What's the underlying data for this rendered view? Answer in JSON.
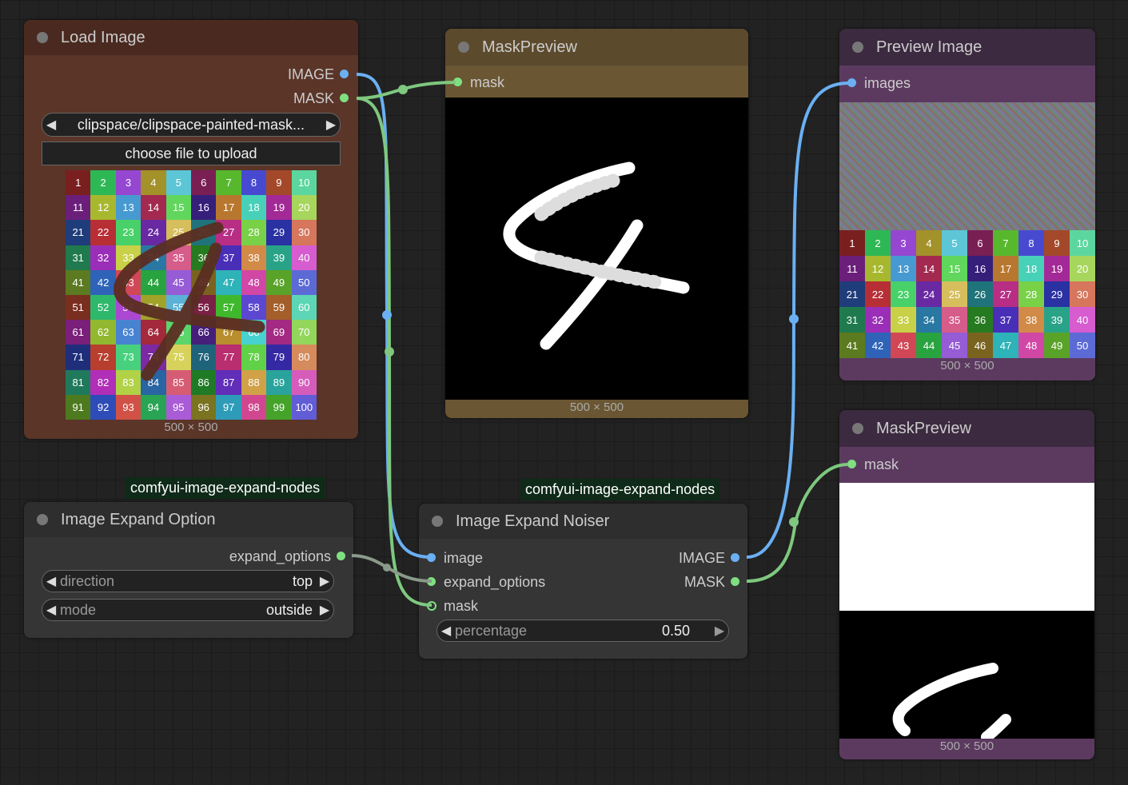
{
  "load_image": {
    "title": "Load Image",
    "outputs": [
      "IMAGE",
      "MASK"
    ],
    "file_value": "clipspace/clipspace-painted-mask...",
    "upload_label": "choose file to upload",
    "size": "500 × 500"
  },
  "mask_preview_1": {
    "title": "MaskPreview",
    "input": "mask",
    "size": "500 × 500"
  },
  "preview_image": {
    "title": "Preview Image",
    "input": "images",
    "size": "500 × 500"
  },
  "mask_preview_2": {
    "title": "MaskPreview",
    "input": "mask",
    "size": "500 × 500"
  },
  "expand_option": {
    "tag": "comfyui-image-expand-nodes",
    "title": "Image Expand Option",
    "output": "expand_options",
    "direction_label": "direction",
    "direction_value": "top",
    "mode_label": "mode",
    "mode_value": "outside"
  },
  "expand_noiser": {
    "tag": "comfyui-image-expand-nodes",
    "title": "Image Expand Noiser",
    "inputs": [
      "image",
      "expand_options",
      "mask"
    ],
    "outputs": [
      "IMAGE",
      "MASK"
    ],
    "percentage_label": "percentage",
    "percentage_value": "0.50"
  },
  "grid_numbers": [
    "1",
    "2",
    "3",
    "4",
    "5",
    "6",
    "7",
    "8",
    "9",
    "10",
    "11",
    "12",
    "13",
    "14",
    "15",
    "16",
    "17",
    "18",
    "19",
    "20",
    "21",
    "22",
    "23",
    "24",
    "25",
    "26",
    "27",
    "28",
    "29",
    "30",
    "31",
    "32",
    "33",
    "34",
    "35",
    "36",
    "37",
    "38",
    "39",
    "40",
    "41",
    "42",
    "43",
    "44",
    "45",
    "46",
    "47",
    "48",
    "49",
    "50",
    "51",
    "52",
    "53",
    "54",
    "55",
    "56",
    "57",
    "58",
    "59",
    "60",
    "61",
    "62",
    "63",
    "64",
    "65",
    "66",
    "67",
    "68",
    "69",
    "70",
    "71",
    "72",
    "73",
    "74",
    "75",
    "76",
    "77",
    "78",
    "79",
    "80",
    "81",
    "82",
    "83",
    "84",
    "85",
    "86",
    "87",
    "88",
    "89",
    "90",
    "91",
    "92",
    "93",
    "94",
    "95",
    "96",
    "97",
    "98",
    "99",
    "100"
  ],
  "colors": {
    "load_node": "#5a3528",
    "load_header": "#4a2a20",
    "mask_node_header": "#5c4a2c",
    "mask_node_bar": "#6a5632",
    "purple_header": "#3c2a40",
    "purple_bar": "#5c3a60",
    "grey_node": "#353535",
    "grey_header": "#2e2e2e",
    "wire_blue": "#6ab0f3",
    "wire_green": "#7ec87f",
    "wire_grey": "#8a9a8a"
  }
}
